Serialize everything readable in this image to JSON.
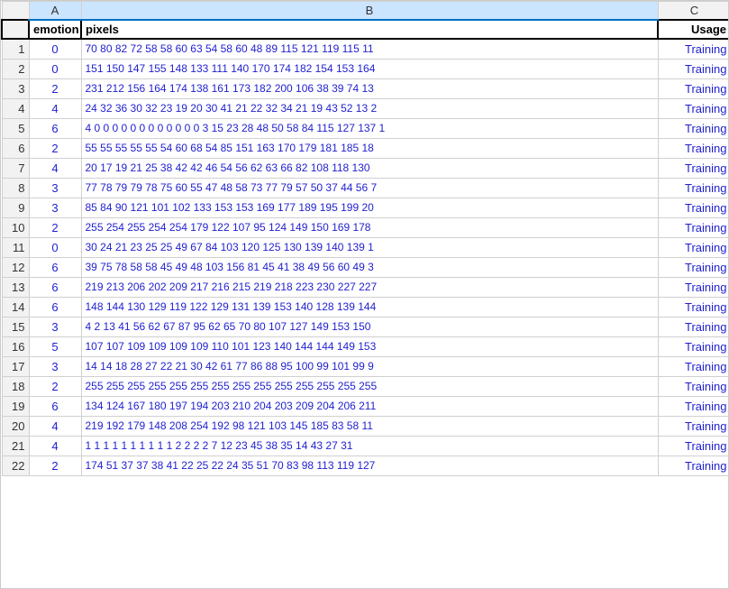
{
  "columns": {
    "a_label": "A",
    "b_label": "B",
    "c_label": "C"
  },
  "headers": {
    "emotion": "emotion",
    "pixels": "pixels",
    "usage": "Usage"
  },
  "rows": [
    {
      "emotion": "0",
      "pixels": "70 80 82 72 58 58 60 63 54 58 60 48 89 115 121 119 115 11",
      "usage": "Training"
    },
    {
      "emotion": "0",
      "pixels": "151 150 147 155 148 133 111 140 170 174 182 154 153 164",
      "usage": "Training"
    },
    {
      "emotion": "2",
      "pixels": "231 212 156 164 174 138 161 173 182 200 106 38 39 74 13",
      "usage": "Training"
    },
    {
      "emotion": "4",
      "pixels": "24 32 36 30 32 23 19 20 30 41 21 22 32 34 21 19 43 52 13 2",
      "usage": "Training"
    },
    {
      "emotion": "6",
      "pixels": "4 0 0 0 0 0 0 0 0 0 0 0 0 3 15 23 28 48 50 58 84 115 127 137 1",
      "usage": "Training"
    },
    {
      "emotion": "2",
      "pixels": "55 55 55 55 55 54 60 68 54 85 151 163 170 179 181 185 18",
      "usage": "Training"
    },
    {
      "emotion": "4",
      "pixels": "20 17 19 21 25 38 42 42 46 54 56 62 63 66 82 108 118 130",
      "usage": "Training"
    },
    {
      "emotion": "3",
      "pixels": "77 78 79 79 78 75 60 55 47 48 58 73 77 79 57 50 37 44 56 7",
      "usage": "Training"
    },
    {
      "emotion": "3",
      "pixels": "85 84 90 121 101 102 133 153 153 169 177 189 195 199 20",
      "usage": "Training"
    },
    {
      "emotion": "2",
      "pixels": "255 254 255 254 254 179 122 107 95 124 149 150 169 178",
      "usage": "Training"
    },
    {
      "emotion": "0",
      "pixels": "30 24 21 23 25 25 49 67 84 103 120 125 130 139 140 139 1",
      "usage": "Training"
    },
    {
      "emotion": "6",
      "pixels": "39 75 78 58 58 45 49 48 103 156 81 45 41 38 49 56 60 49 3",
      "usage": "Training"
    },
    {
      "emotion": "6",
      "pixels": "219 213 206 202 209 217 216 215 219 218 223 230 227 227",
      "usage": "Training"
    },
    {
      "emotion": "6",
      "pixels": "148 144 130 129 119 122 129 131 139 153 140 128 139 144",
      "usage": "Training"
    },
    {
      "emotion": "3",
      "pixels": "4 2 13 41 56 62 67 87 95 62 65 70 80 107 127 149 153 150",
      "usage": "Training"
    },
    {
      "emotion": "5",
      "pixels": "107 107 109 109 109 109 110 101 123 140 144 144 149 153",
      "usage": "Training"
    },
    {
      "emotion": "3",
      "pixels": "14 14 18 28 27 22 21 30 42 61 77 86 88 95 100 99 101 99 9",
      "usage": "Training"
    },
    {
      "emotion": "2",
      "pixels": "255 255 255 255 255 255 255 255 255 255 255 255 255 255",
      "usage": "Training"
    },
    {
      "emotion": "6",
      "pixels": "134 124 167 180 197 194 203 210 204 203 209 204 206 211",
      "usage": "Training"
    },
    {
      "emotion": "4",
      "pixels": "219 192 179 148 208 254 192 98 121 103 145 185 83 58 11",
      "usage": "Training"
    },
    {
      "emotion": "4",
      "pixels": "1 1 1 1 1 1 1 1 1 1 2 2 2 2 7 12 23 45 38 35 14 43 27 31",
      "usage": "Training"
    },
    {
      "emotion": "2",
      "pixels": "174 51 37 37 38 41 22 25 22 24 35 51 70 83 98 113 119 127",
      "usage": "Training"
    }
  ]
}
